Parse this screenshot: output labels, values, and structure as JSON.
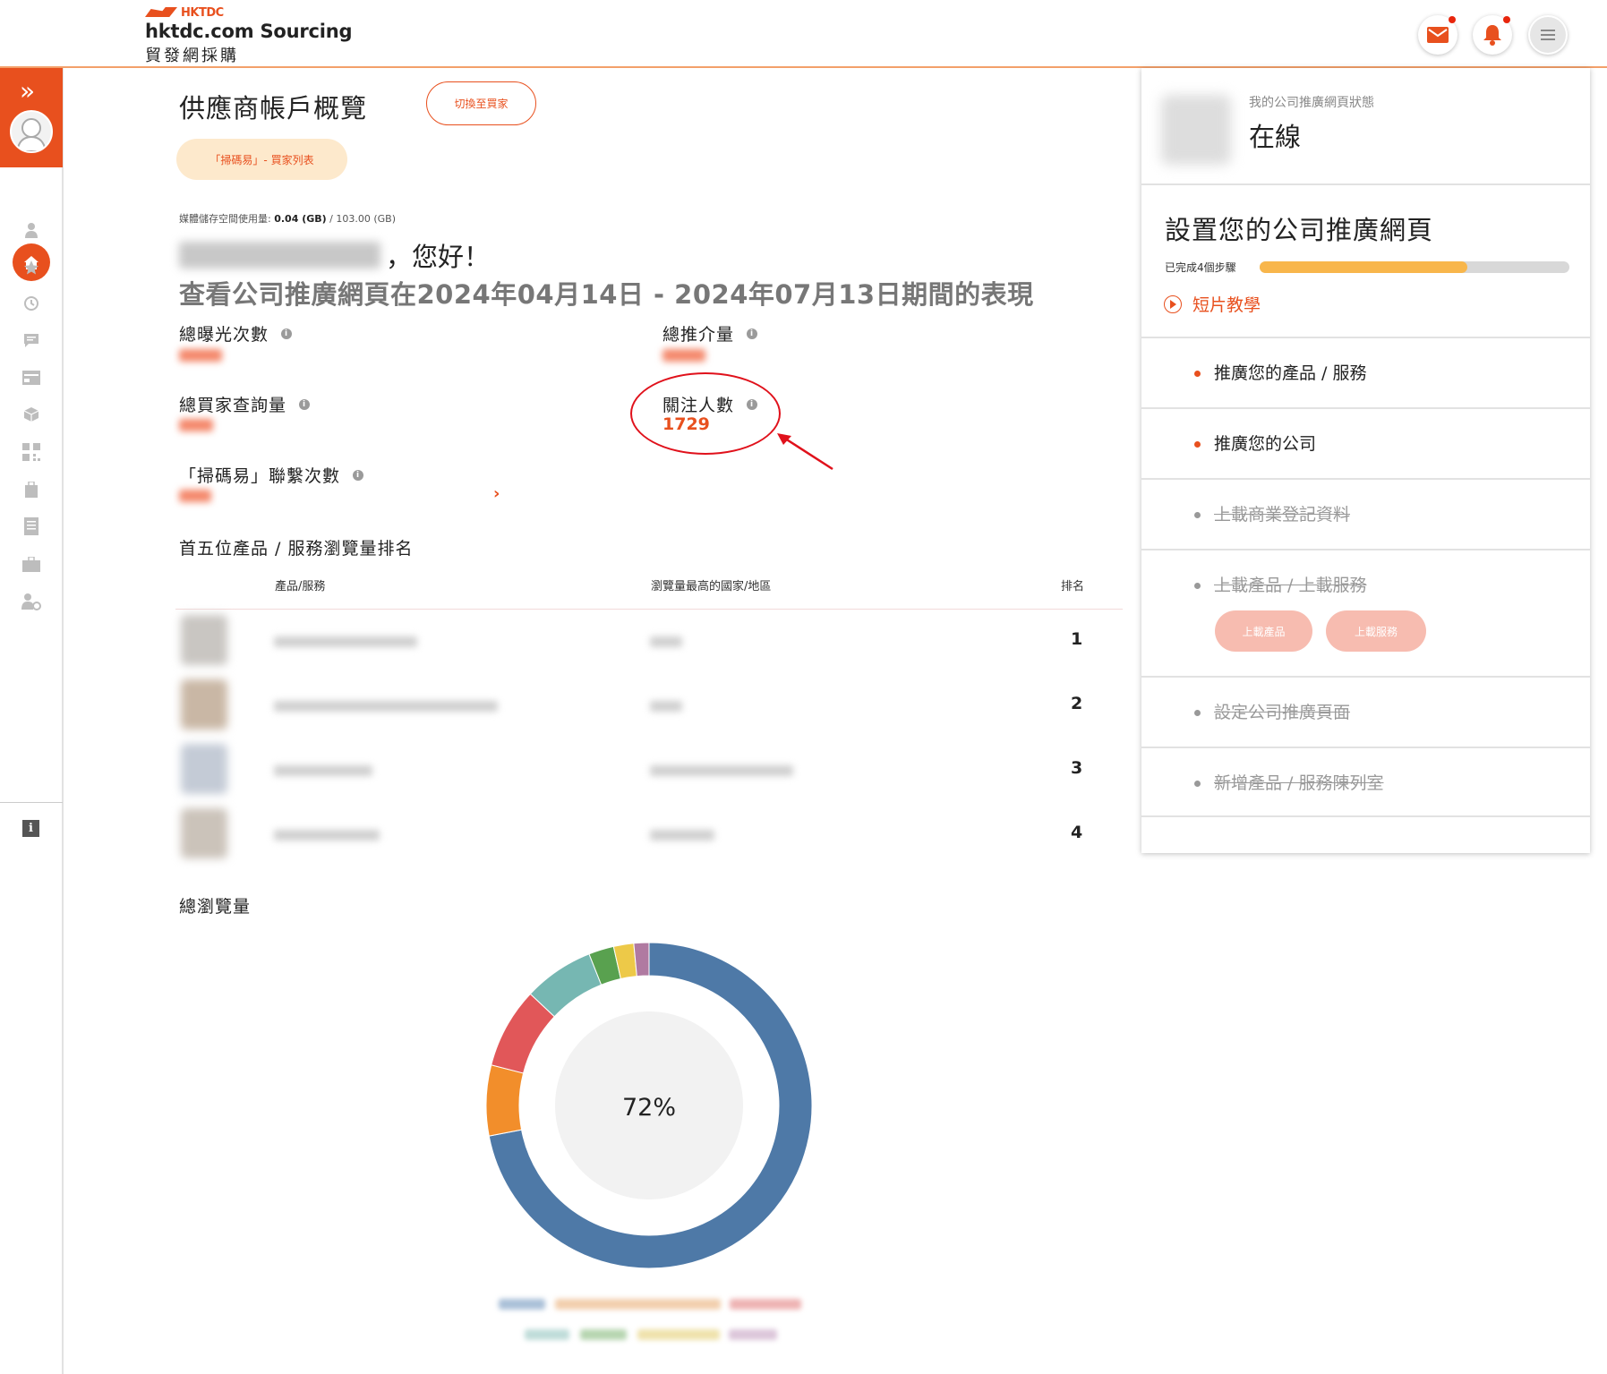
{
  "header": {
    "logo_brand": "HKTDC",
    "logo_title": "hktdc.com Sourcing",
    "logo_subtitle": "貿發網採購",
    "icons": [
      "mail-icon",
      "bell-icon",
      "menu-icon"
    ],
    "accent_color": "#e8501e"
  },
  "sidebar": {
    "icons": [
      "home-icon",
      "user-icon",
      "star-icon",
      "history-icon",
      "message-icon",
      "card-icon",
      "box-icon",
      "qr-icon",
      "bag-icon",
      "list-icon",
      "briefcase-icon",
      "user-settings-icon",
      "info-icon"
    ]
  },
  "main": {
    "title": "供應商帳戶概覽",
    "switch_button": "切換至買家",
    "scan_pill": "「掃碼易」- 買家列表",
    "storage_label": "媒體儲存空間使用量:",
    "storage_used": "0.04 (GB)",
    "storage_total": "/ 103.00 (GB)",
    "greeting_suffix": "，您好！",
    "period_text": "查看公司推廣網頁在2024年04月14日 - 2024年07月13日期間的表現",
    "metrics": {
      "exposure_label": "總曝光次數",
      "referrals_label": "總推介量",
      "inquiries_label": "總買家查詢量",
      "followers_label": "關注人數",
      "followers_value": "1729",
      "scan_contacts_label": "「掃碼易」聯繫次數"
    },
    "ranking": {
      "title": "首五位產品 / 服務瀏覽量排名",
      "col_product": "產品/服務",
      "col_region": "瀏覽量最高的國家/地區",
      "col_rank": "排名",
      "ranks": [
        "1",
        "2",
        "3",
        "4"
      ]
    },
    "views_title": "總瀏覽量",
    "donut_center": "72%"
  },
  "right_panel": {
    "status_label": "我的公司推廣網頁狀態",
    "status_value": "在線",
    "setup_title": "設置您的公司推廣網頁",
    "steps_done": "已完成4個步驟",
    "progress_fraction": 0.67,
    "video_link": "短片教學",
    "items": [
      {
        "label": "推廣您的產品 / 服務",
        "done": false
      },
      {
        "label": "推廣您的公司",
        "done": false
      },
      {
        "label": "上載商業登記資料",
        "done": true
      },
      {
        "label": "上載產品 / 上載服務",
        "done": true
      },
      {
        "label": "設定公司推廣頁面",
        "done": true
      },
      {
        "label": "新增產品 / 服務陳列室",
        "done": true
      }
    ],
    "upload_product": "上載產品",
    "upload_service": "上載服務"
  },
  "chart_data": {
    "type": "pie",
    "title": "總瀏覽量",
    "center_label": "72%",
    "slices": [
      {
        "value": 72,
        "color": "#4e79a7"
      },
      {
        "value": 7,
        "color": "#f28e2b"
      },
      {
        "value": 8,
        "color": "#e15759"
      },
      {
        "value": 7,
        "color": "#76b7b2"
      },
      {
        "value": 2.5,
        "color": "#59a14f"
      },
      {
        "value": 2,
        "color": "#edc948"
      },
      {
        "value": 1.5,
        "color": "#b07aa1"
      }
    ]
  }
}
